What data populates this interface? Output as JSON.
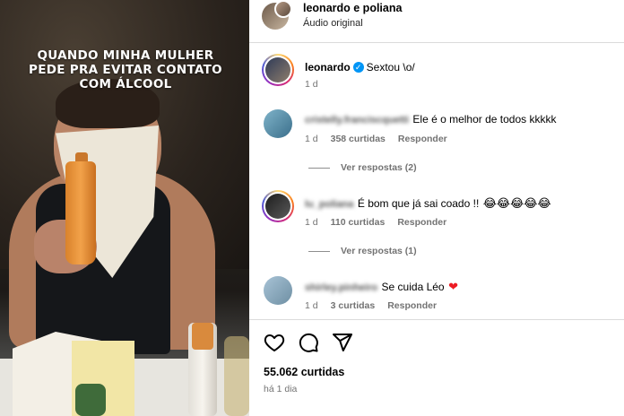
{
  "video": {
    "overlay_text": "QUANDO MINHA MULHER PEDE PRA EVITAR CONTATO COM ÁLCOOL"
  },
  "header": {
    "title": "leonardo e poliana",
    "subtitle": "Áudio original"
  },
  "caption": {
    "username": "leonardo",
    "text": "Sextou \\o/",
    "time": "1 d"
  },
  "comments": [
    {
      "username": "cristelly.franciscquetti",
      "text": "Ele é o melhor de todos kkkkk",
      "time": "1 d",
      "likes": "358 curtidas",
      "reply": "Responder",
      "view_replies": "Ver respostas (2)"
    },
    {
      "username": "lu_poliana",
      "text": "É bom que já sai coado !!",
      "emoji": "😂😂😂😂😂",
      "time": "1 d",
      "likes": "110 curtidas",
      "reply": "Responder",
      "view_replies": "Ver respostas (1)"
    },
    {
      "username": "shirley.pinheiro",
      "text": "Se cuida Léo",
      "emoji": "❤",
      "time": "1 d",
      "likes": "3 curtidas",
      "reply": "Responder"
    }
  ],
  "footer": {
    "likes": "55.062 curtidas",
    "time_ago": "há 1 dia"
  },
  "icons": {
    "like": "heart-icon",
    "comment": "comment-icon",
    "share": "send-icon",
    "verified": "verified-badge-icon"
  },
  "colors": {
    "verified": "#0095f6",
    "heart": "#ed1c24",
    "muted": "#737373"
  }
}
